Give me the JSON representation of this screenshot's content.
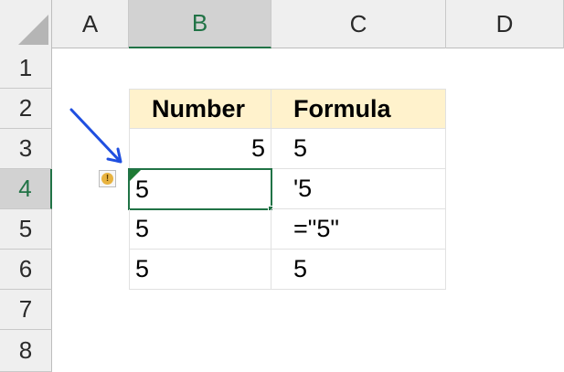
{
  "columns": [
    "A",
    "B",
    "C",
    "D"
  ],
  "rows": [
    "1",
    "2",
    "3",
    "4",
    "5",
    "6",
    "7",
    "8"
  ],
  "selected_column": "B",
  "selected_row": "4",
  "table": {
    "headers": [
      "Number",
      "Formula"
    ],
    "rows": [
      [
        "5",
        "5"
      ],
      [
        "5",
        "'5"
      ],
      [
        "5",
        "=\"5\""
      ],
      [
        "5",
        "5"
      ]
    ]
  },
  "colors": {
    "header_fill": "#fff2cc",
    "accent": "#217346",
    "arrow": "#1f4fe0",
    "warning": "#e8b33f"
  },
  "icons": {
    "warning": "warning-icon",
    "arrow": "pointer-arrow-icon",
    "error_indicator": "error-indicator-icon"
  }
}
